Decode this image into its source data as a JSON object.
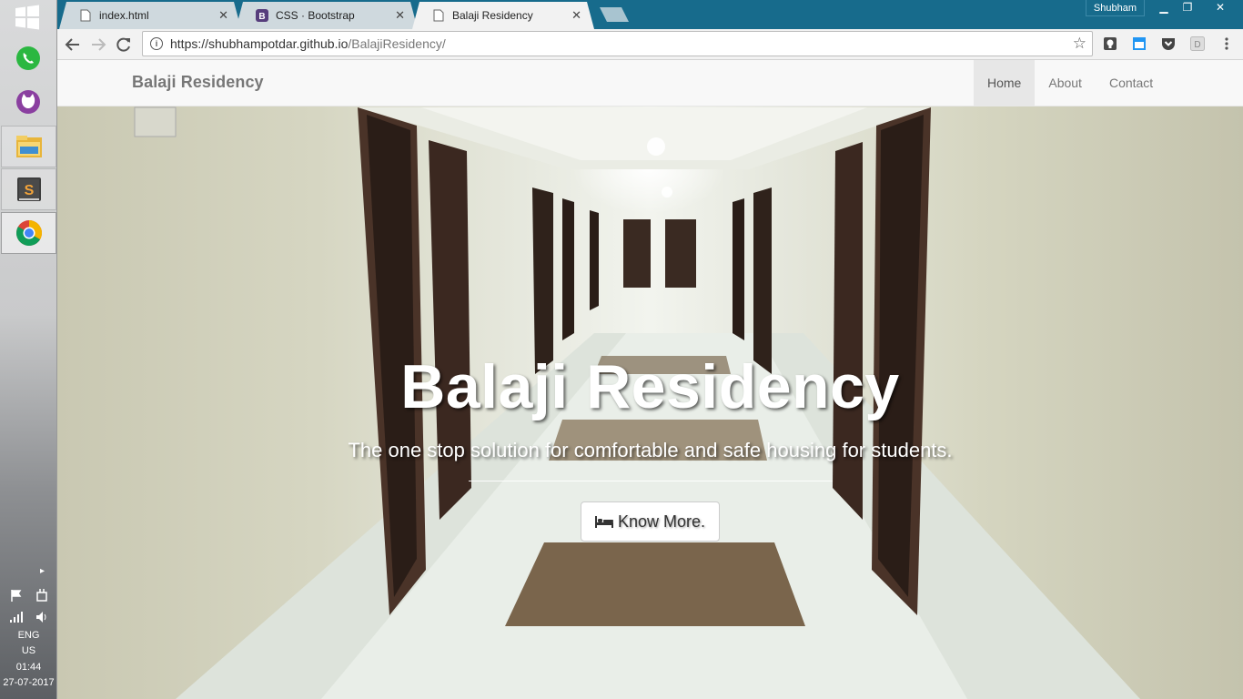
{
  "os": {
    "user": "Shubham",
    "tray": {
      "lang": "ENG",
      "region": "US",
      "time": "01:44",
      "date": "27-07-2017"
    }
  },
  "browser": {
    "tabs": [
      {
        "label": "index.html",
        "icon": "page-icon"
      },
      {
        "label": "CSS · Bootstrap",
        "icon": "bootstrap-icon"
      },
      {
        "label": "Balaji Residency",
        "icon": "page-icon"
      }
    ],
    "url_host": "https://shubhampotdar.github.io",
    "url_path": "/BalajiResidency/"
  },
  "page": {
    "brand": "Balaji Residency",
    "nav": [
      "Home",
      "About",
      "Contact"
    ],
    "active_nav": "Home",
    "hero_title": "Balaji Residency",
    "hero_subtitle": "The one stop solution for comfortable and safe housing for students.",
    "cta_label": "Know More.",
    "cta_icon": "bed-icon"
  },
  "colors": {
    "tabstrip": "#176b8c",
    "navbar": "#f8f8f8",
    "nav_text": "#777777"
  }
}
